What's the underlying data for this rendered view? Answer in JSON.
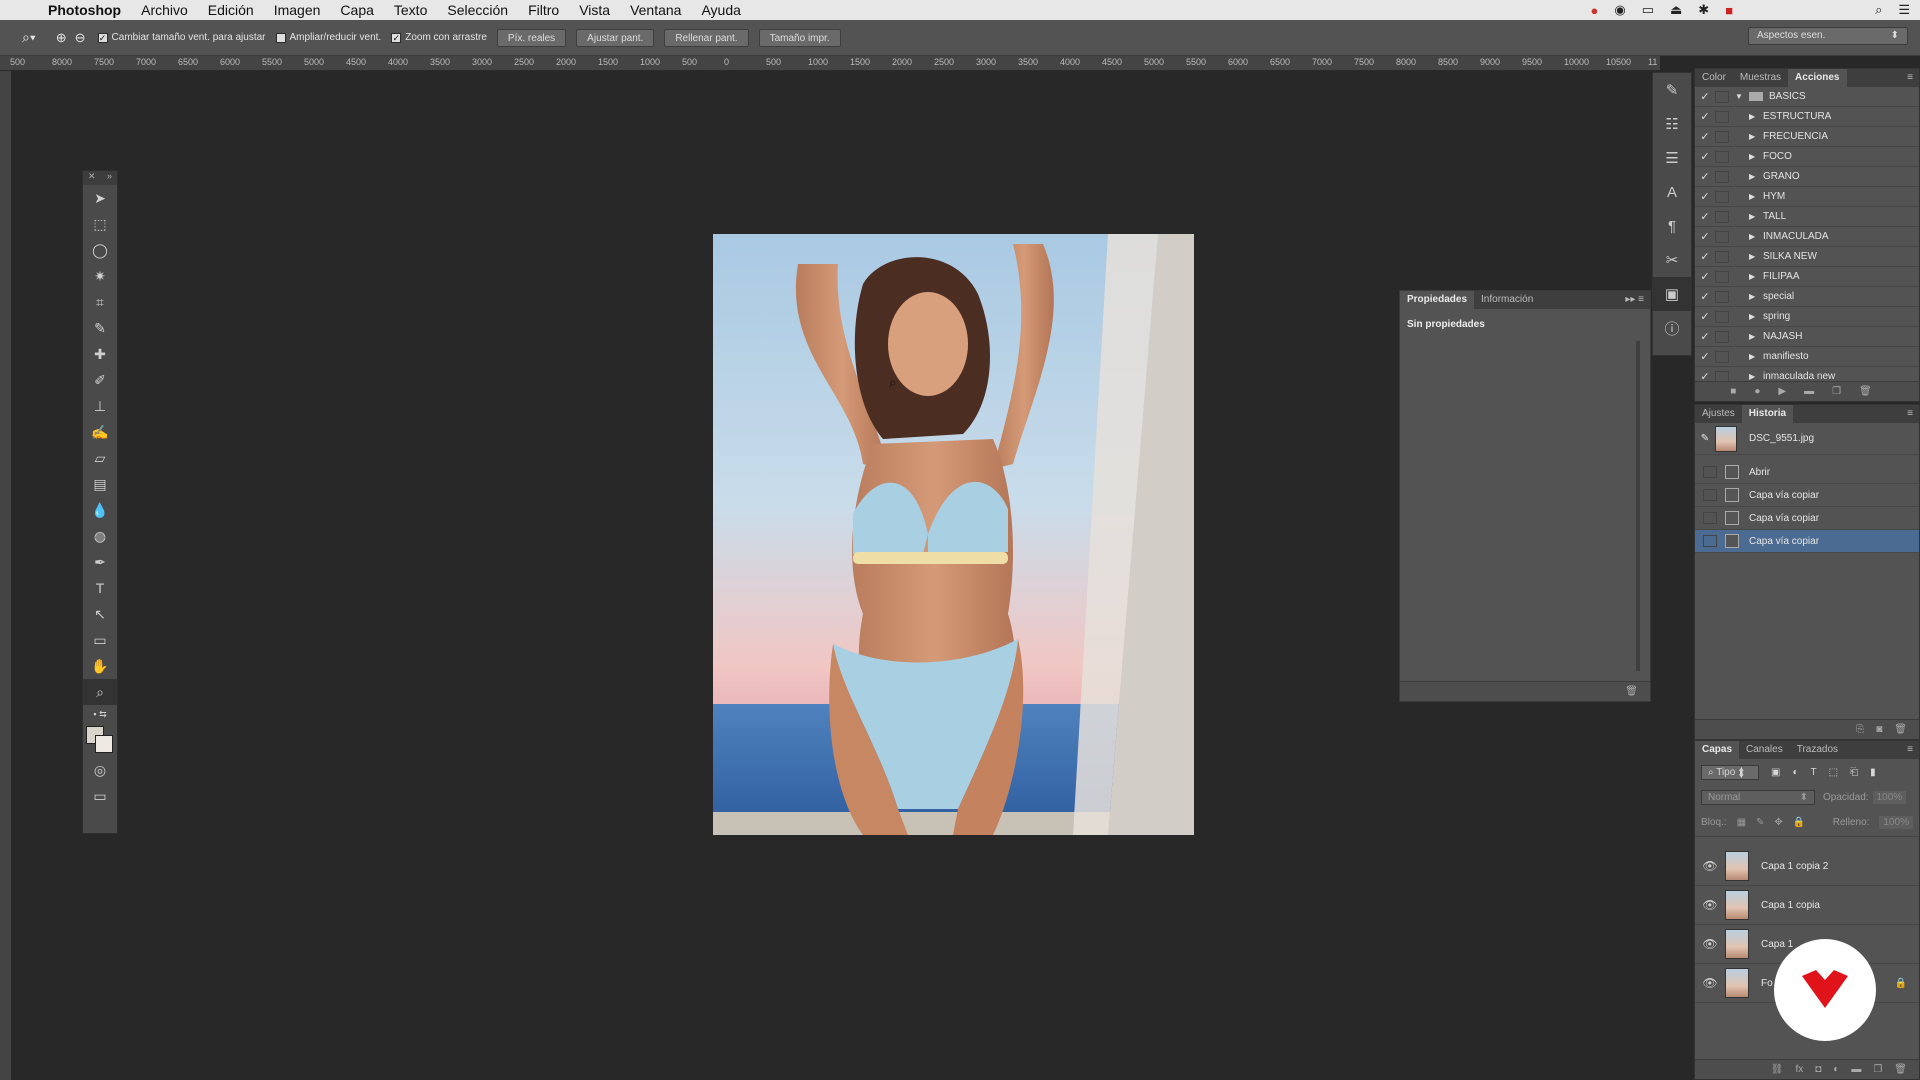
{
  "menubar": {
    "app": "Photoshop",
    "items": [
      "Archivo",
      "Edición",
      "Imagen",
      "Capa",
      "Texto",
      "Selección",
      "Filtro",
      "Vista",
      "Ventana",
      "Ayuda"
    ]
  },
  "options": {
    "resize_windows": "Cambiar tamaño vent. para ajustar",
    "zoom_all": "Ampliar/reducir vent.",
    "scrubby_zoom": "Zoom con arrastre",
    "buttons": [
      "Píx. reales",
      "Ajustar pant.",
      "Rellenar pant.",
      "Tamaño impr."
    ],
    "workspace": "Aspectos esen."
  },
  "ruler": {
    "ticks": [
      "500",
      "8000",
      "7500",
      "7000",
      "6500",
      "6000",
      "5500",
      "5000",
      "4500",
      "4000",
      "3500",
      "3000",
      "2500",
      "2000",
      "1500",
      "1000",
      "500",
      "0",
      "500",
      "1000",
      "1500",
      "2000",
      "2500",
      "3000",
      "3500",
      "4000",
      "4500",
      "5000",
      "5500",
      "6000",
      "6500",
      "7000",
      "7500",
      "8000",
      "8500",
      "9000",
      "9500",
      "10000",
      "10500",
      "11"
    ]
  },
  "properties": {
    "tabs": [
      "Propiedades",
      "Información"
    ],
    "empty": "Sin propiedades"
  },
  "actions": {
    "tabs": [
      "Color",
      "Muestras",
      "Acciones"
    ],
    "set": "BASICS",
    "items": [
      "ESTRUCTURA",
      "FRECUENCIA",
      "FOCO",
      "GRANO",
      "HYM",
      "TALL",
      "INMACULADA",
      "SILKA NEW",
      "FILIPAA",
      "special",
      "spring",
      "NAJASH",
      "manifiesto",
      "inmaculada new"
    ]
  },
  "history": {
    "tabs": [
      "Ajustes",
      "Historia"
    ],
    "snapshot": "DSC_9551.jpg",
    "steps": [
      "Abrir",
      "Capa vía copiar",
      "Capa vía copiar",
      "Capa vía copiar"
    ]
  },
  "layers": {
    "tabs": [
      "Capas",
      "Canales",
      "Trazados"
    ],
    "filter": "Tipo",
    "blend": "Normal",
    "opacity_label": "Opacidad:",
    "opacity": "100%",
    "lock_label": "Bloq.:",
    "fill_label": "Relleno:",
    "fill": "100%",
    "items": [
      "Capa 1 copia 2",
      "Capa 1 copia",
      "Capa 1",
      "Fo"
    ]
  },
  "colors": {
    "selection": "#4b6b92",
    "badge_red": "#e0131b"
  }
}
